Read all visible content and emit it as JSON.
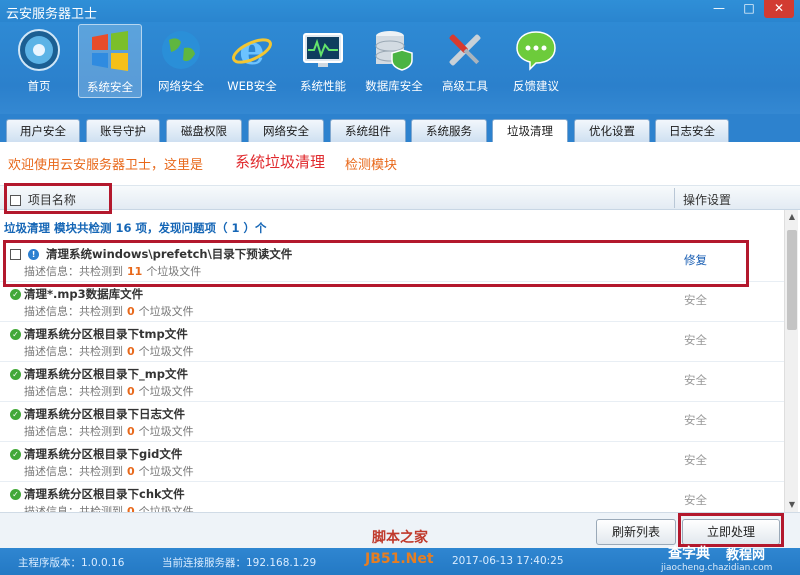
{
  "app": {
    "title": "云安服务器卫士"
  },
  "window_controls": [
    "—",
    "□",
    "✕"
  ],
  "toolbar": [
    {
      "label": "首页",
      "icon": "home-globe-icon"
    },
    {
      "label": "系统安全",
      "icon": "windows-logo-icon"
    },
    {
      "label": "网络安全",
      "icon": "globe-icon"
    },
    {
      "label": "WEB安全",
      "icon": "ie-browser-icon"
    },
    {
      "label": "系统性能",
      "icon": "monitor-chart-icon"
    },
    {
      "label": "数据库安全",
      "icon": "database-shield-icon"
    },
    {
      "label": "高级工具",
      "icon": "tools-icon"
    },
    {
      "label": "反馈建议",
      "icon": "chat-bubble-icon"
    }
  ],
  "tabs": [
    "用户安全",
    "账号守护",
    "磁盘权限",
    "网络安全",
    "系统组件",
    "系统服务",
    "垃圾清理",
    "优化设置",
    "日志安全"
  ],
  "welcome": {
    "prefix": "欢迎使用云安服务器卫士，这里是",
    "module": "系统垃圾清理",
    "suffix": "检测模块"
  },
  "columns": {
    "name": "项目名称",
    "action": "操作设置"
  },
  "summary": "垃圾清理 模块共检测 16 项，发现问题项（ 1 ）个",
  "desc_prefix": "描述信息：共检测到",
  "desc_suffix": "个垃圾文件",
  "items": [
    {
      "name": "清理系统windows\\prefetch\\目录下预读文件",
      "count": "11",
      "action": "修复",
      "problem": true
    },
    {
      "name": "清理*.mp3数据库文件",
      "count": "0",
      "action": "安全",
      "problem": false
    },
    {
      "name": "清理系统分区根目录下tmp文件",
      "count": "0",
      "action": "安全",
      "problem": false
    },
    {
      "name": "清理系统分区根目录下_mp文件",
      "count": "0",
      "action": "安全",
      "problem": false
    },
    {
      "name": "清理系统分区根目录下日志文件",
      "count": "0",
      "action": "安全",
      "problem": false
    },
    {
      "name": "清理系统分区根目录下gid文件",
      "count": "0",
      "action": "安全",
      "problem": false
    },
    {
      "name": "清理系统分区根目录下chk文件",
      "count": "0",
      "action": "安全",
      "problem": false
    }
  ],
  "buttons": {
    "refresh": "刷新列表",
    "process": "立即处理"
  },
  "status": {
    "version": "主程序版本：1.0.0.16",
    "server": "当前连接服务器：192.168.1.29",
    "time": "2017-06-13 17:40:25"
  },
  "watermarks": {
    "w1": "脚本之家",
    "w2": "JB51.Net",
    "w3": "查字典",
    "w4": "教程网",
    "w5": "jiaocheng.chazidian.com"
  },
  "colors": {
    "accent": "#2d82ce",
    "highlight": "#b3182d",
    "warning": "#e8681a"
  }
}
